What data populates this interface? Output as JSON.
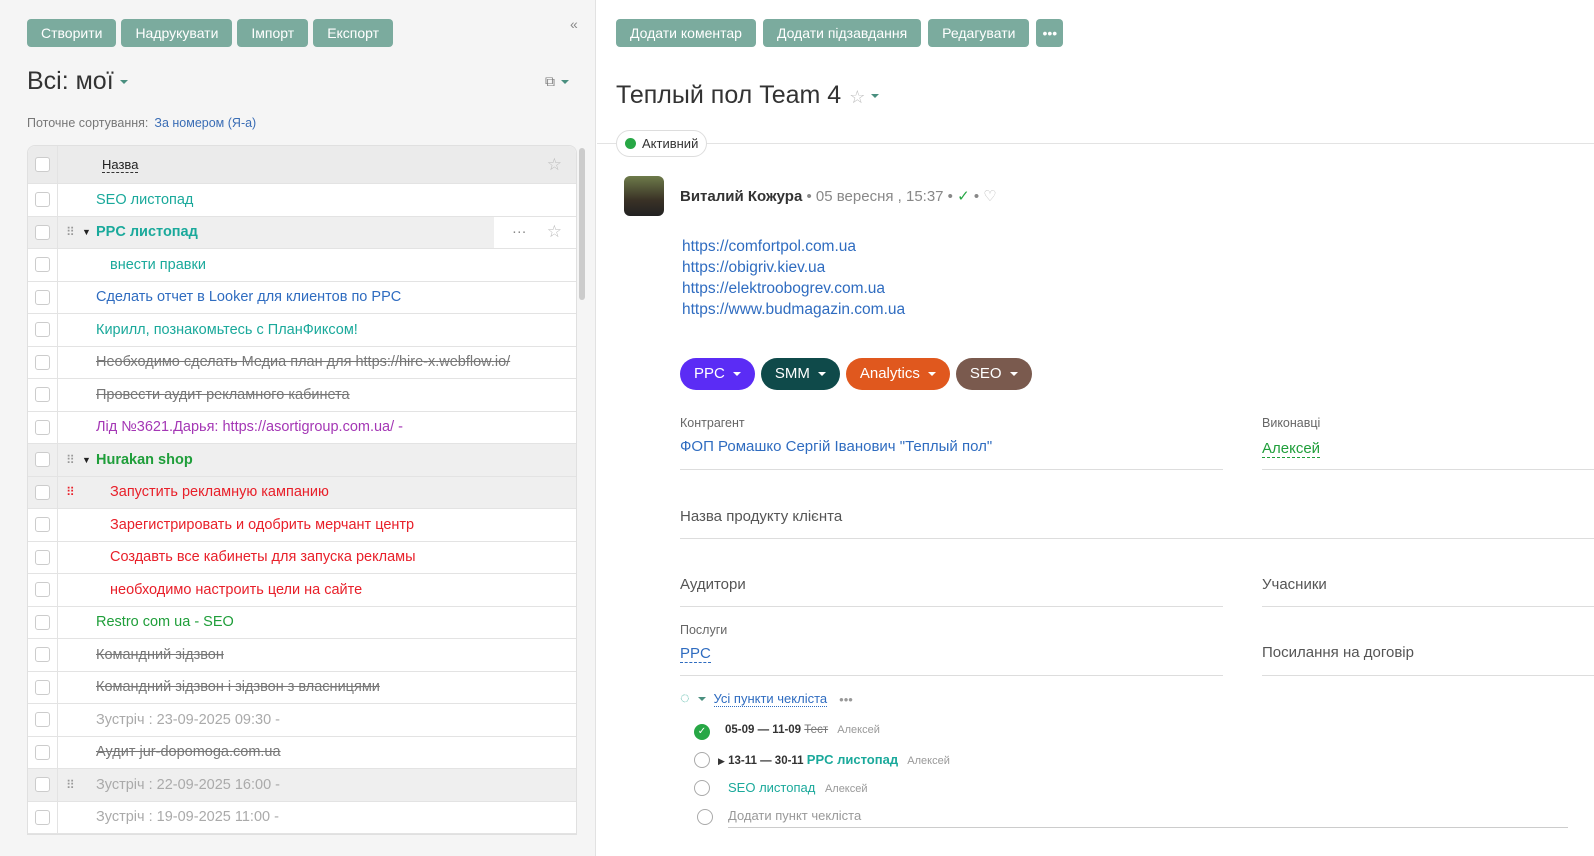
{
  "left": {
    "toolbar": [
      "Створити",
      "Надрукувати",
      "Імпорт",
      "Експорт"
    ],
    "collapse": "«",
    "title": "Всі: мої",
    "sort_label": "Поточне сортування:",
    "sort_value": "За номером (Я-а)",
    "column_header": "Назва",
    "rows": [
      {
        "name": "SEO листопад",
        "color": "#1aa99b"
      },
      {
        "name": "PPC листопад",
        "color": "#1aa99b",
        "bold": true,
        "group": true,
        "hover": true
      },
      {
        "name": "внести правки",
        "color": "#1aa99b",
        "indent": true
      },
      {
        "name": "Сделать отчет в Looker для клиентов по PPC",
        "color": "#2f6cc0"
      },
      {
        "name": "Кирилл, познакомьтесь с ПланФиксом!",
        "color": "#1aa99b"
      },
      {
        "name": "Необходимо сделать Медиа план для https://hire-x.webflow.io/",
        "color": "#777",
        "strike": true
      },
      {
        "name": "Провести аудит рекламного кабинета",
        "color": "#777",
        "strike": true
      },
      {
        "name": "Лід №3621.Дарья: https://asortigroup.com.ua/ -",
        "color": "#a437b5"
      },
      {
        "name": "Hurakan shop",
        "color": "#1f9e3a",
        "bold": true,
        "group": true,
        "gray": true
      },
      {
        "name": "Запустить рекламную кампанию",
        "color": "#e8202a",
        "indent": true,
        "gray": true,
        "reddrag": true
      },
      {
        "name": "Зарегистрировать и одобрить мерчант центр",
        "color": "#e8202a",
        "indent": true
      },
      {
        "name": "Создавть все кабинеты для запуска рекламы",
        "color": "#e8202a",
        "indent": true
      },
      {
        "name": "необходимо настроить цели на сайте",
        "color": "#e8202a",
        "indent": true
      },
      {
        "name": "Restro com ua - SEO",
        "color": "#1f9e3a"
      },
      {
        "name": "Командний зідзвон",
        "color": "#777",
        "strike": true
      },
      {
        "name": "Командний зідзвон і зідзвон з власницями",
        "color": "#777",
        "strike": true
      },
      {
        "name": "Зустріч : 23-09-2025 09:30 -",
        "color": "#aaa"
      },
      {
        "name": "Аудит jur-dopomoga.com.ua",
        "color": "#777",
        "strike": true
      },
      {
        "name": "Зустріч : 22-09-2025 16:00 -",
        "color": "#aaa",
        "gray": true,
        "drag": true
      },
      {
        "name": "Зустріч : 19-09-2025 11:00 -",
        "color": "#aaa"
      }
    ]
  },
  "right": {
    "toolbar": [
      "Додати коментар",
      "Додати підзавдання",
      "Редагувати",
      "•••"
    ],
    "title": "Теплый пол Team 4",
    "status": "Активний",
    "author": "Виталий Кожура",
    "date": "05 вересня , 15:37",
    "links": [
      "https://comfortpol.com.ua",
      "https://obigriv.kiev.ua",
      "https://elektroobogrev.com.ua",
      "https://www.budmagazin.com.ua"
    ],
    "tags": [
      {
        "label": "PPC",
        "color": "#5b2cf5"
      },
      {
        "label": "SMM",
        "color": "#0f4a4a"
      },
      {
        "label": "Analytics",
        "color": "#e0581e"
      },
      {
        "label": "SEO",
        "color": "#7a5a4e"
      }
    ],
    "fields": {
      "contractor_label": "Контрагент",
      "contractor": "ФОП Ромашко Сергій Іванович \"Теплый пол\"",
      "executors_label": "Виконавці",
      "executor": "Алексей",
      "product": "Назва продукту клієнта",
      "audiences": "Аудитори",
      "participants": "Учасники",
      "services_label": "Послуги",
      "service": "PPC",
      "contract": "Посилання на договір"
    },
    "checklist": {
      "title": "Усі пункти чекліста",
      "items": [
        {
          "dates": "05-09 — 11-09",
          "name": "Тест",
          "user": "Алексей",
          "done": true
        },
        {
          "dates": "13-11 — 30-11",
          "name": "PPC листопад",
          "user": "Алексей"
        },
        {
          "dates": "",
          "name": "SEO листопад",
          "user": "Алексей"
        }
      ],
      "add": "Додати пункт чекліста"
    }
  }
}
